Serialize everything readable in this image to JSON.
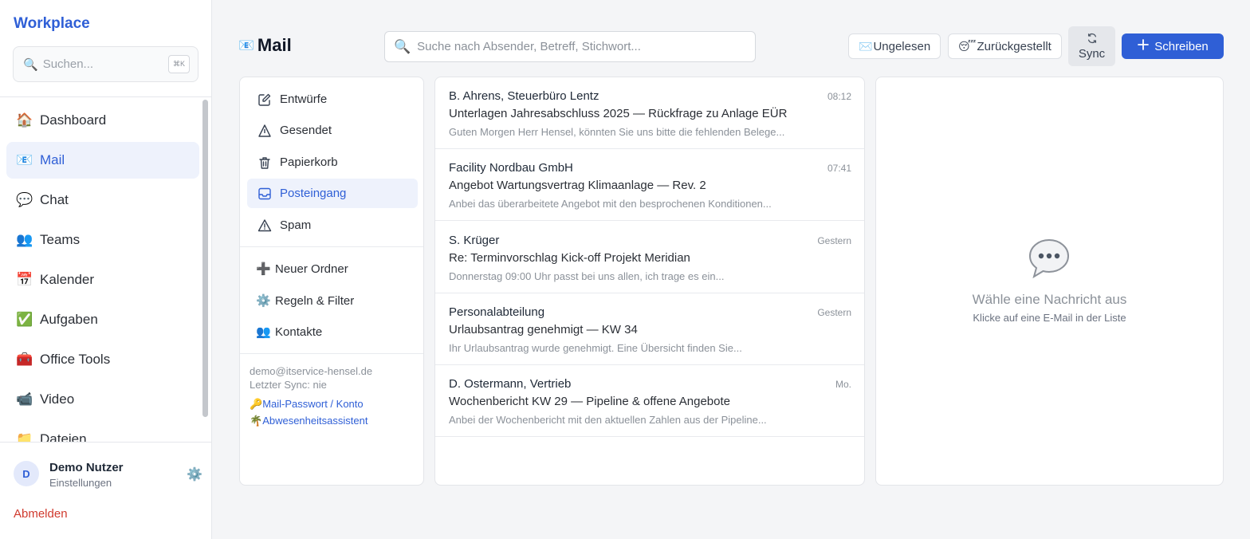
{
  "sidebar": {
    "brand": "Workplace",
    "search_placeholder": "Suchen...",
    "search_shortcut": "⌘K",
    "items": [
      {
        "icon": "house-icon",
        "glyph": "🏠",
        "label": "Dashboard"
      },
      {
        "icon": "mail-icon",
        "glyph": "📧",
        "label": "Mail"
      },
      {
        "icon": "speech-bubble-icon",
        "glyph": "💬",
        "label": "Chat"
      },
      {
        "icon": "people-icon",
        "glyph": "👥",
        "label": "Teams"
      },
      {
        "icon": "calendar-icon",
        "glyph": "📅",
        "label": "Kalender"
      },
      {
        "icon": "checkmark-icon",
        "glyph": "✅",
        "label": "Aufgaben"
      },
      {
        "icon": "toolbox-icon",
        "glyph": "🧰",
        "label": "Office Tools"
      },
      {
        "icon": "video-camera-icon",
        "glyph": "📹",
        "label": "Video"
      },
      {
        "icon": "folder-icon",
        "glyph": "📁",
        "label": "Dateien"
      }
    ],
    "active_item": "Mail",
    "user": {
      "initial": "D",
      "name": "Demo Nutzer",
      "subtitle": "Einstellungen"
    },
    "logout_label": "Abmelden"
  },
  "header": {
    "title_glyph": "📧",
    "title": "Mail",
    "search_placeholder": "Suche nach Absender, Betreff, Stichwort...",
    "buttons": {
      "unread_glyph": "✉️",
      "unread": "Ungelesen",
      "snoozed_glyph": "😴",
      "snoozed": "Zurückgestellt",
      "sync": "Sync",
      "compose": "Schreiben"
    }
  },
  "folders": {
    "items": [
      {
        "icon": "edit-icon",
        "label": "Entwürfe"
      },
      {
        "icon": "sent-icon",
        "label": "Gesendet"
      },
      {
        "icon": "trash-icon",
        "label": "Papierkorb"
      },
      {
        "icon": "inbox-icon",
        "label": "Posteingang"
      },
      {
        "icon": "warning-icon",
        "label": "Spam"
      }
    ],
    "active": "Posteingang",
    "extras": [
      {
        "icon": "plus-icon",
        "glyph": "➕",
        "label": "Neuer Ordner"
      },
      {
        "icon": "gear-icon",
        "glyph": "⚙️",
        "label": "Regeln & Filter"
      },
      {
        "icon": "people-icon",
        "glyph": "👥",
        "label": "Kontakte"
      }
    ],
    "account_email": "demo@itservice-hensel.de",
    "last_sync": "Letzter Sync: nie",
    "links": [
      {
        "icon": "key-icon",
        "glyph": "🔑",
        "label": "Mail-Passwort / Konto"
      },
      {
        "icon": "palm-tree-icon",
        "glyph": "🌴",
        "label": "Abwesenheitsassistent"
      }
    ]
  },
  "messages": [
    {
      "from": "B. Ahrens, Steuerbüro Lentz",
      "time": "08:12",
      "subject": "Unterlagen Jahresabschluss 2025 — Rückfrage zu Anlage EÜR",
      "preview": "Guten Morgen Herr Hensel, könnten Sie uns bitte die fehlenden Belege..."
    },
    {
      "from": "Facility Nordbau GmbH",
      "time": "07:41",
      "subject": "Angebot Wartungsvertrag Klimaanlage — Rev. 2",
      "preview": "Anbei das überarbeitete Angebot mit den besprochenen Konditionen..."
    },
    {
      "from": "S. Krüger",
      "time": "Gestern",
      "subject": "Re: Terminvorschlag Kick-off Projekt Meridian",
      "preview": "Donnerstag 09:00 Uhr passt bei uns allen, ich trage es ein..."
    },
    {
      "from": "Personalabteilung",
      "time": "Gestern",
      "subject": "Urlaubsantrag genehmigt — KW 34",
      "preview": "Ihr Urlaubsantrag wurde genehmigt. Eine Übersicht finden Sie..."
    },
    {
      "from": "D. Ostermann, Vertrieb",
      "time": "Mo.",
      "subject": "Wochenbericht KW 29 — Pipeline & offene Angebote",
      "preview": "Anbei der Wochenbericht mit den aktuellen Zahlen aus der Pipeline..."
    }
  ],
  "reader": {
    "empty_title": "Wähle eine Nachricht aus",
    "empty_subtitle": "Klicke auf eine E-Mail in der Liste"
  },
  "colors": {
    "accent": "#2f5fd6",
    "danger": "#d03a2e",
    "active_bg": "#eef2fc"
  }
}
